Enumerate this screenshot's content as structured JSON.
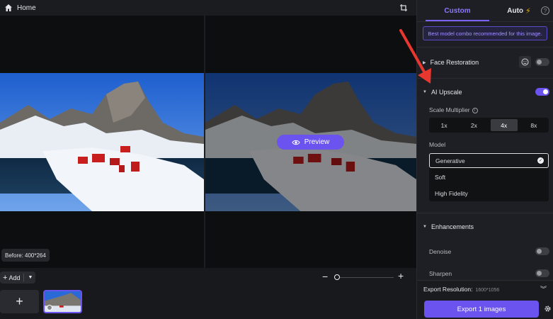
{
  "topbar": {
    "home_label": "Home"
  },
  "canvas": {
    "preview_label": "Preview",
    "before_badge": "Before: 400*264"
  },
  "bottom": {
    "add_label": "Add",
    "add_tile": "+",
    "zoom_minus": "−",
    "zoom_plus": "+"
  },
  "panel": {
    "tabs": {
      "custom": "Custom",
      "auto": "Auto"
    },
    "recommendation": "Best model combo recommended for this image.",
    "face_restoration": {
      "label": "Face Restoration",
      "enabled": false
    },
    "ai_upscale": {
      "label": "AI Upscale",
      "enabled": true,
      "scale_label": "Scale Multiplier",
      "scales": [
        "1x",
        "2x",
        "4x",
        "8x"
      ],
      "selected_scale": "4x",
      "model_label": "Model",
      "models": [
        "Generative",
        "Soft",
        "High Fidelity"
      ],
      "selected_model": "Generative"
    },
    "enhancements": {
      "label": "Enhancements",
      "denoise_label": "Denoise",
      "denoise_enabled": false,
      "sharpen_label": "Sharpen",
      "sharpen_enabled": false
    },
    "export": {
      "resolution_label": "Export Resolution:",
      "resolution_value": "1600*1056",
      "button_label": "Export 1 images"
    }
  },
  "colors": {
    "accent": "#6b53ef",
    "annotation": "#e8372f"
  }
}
